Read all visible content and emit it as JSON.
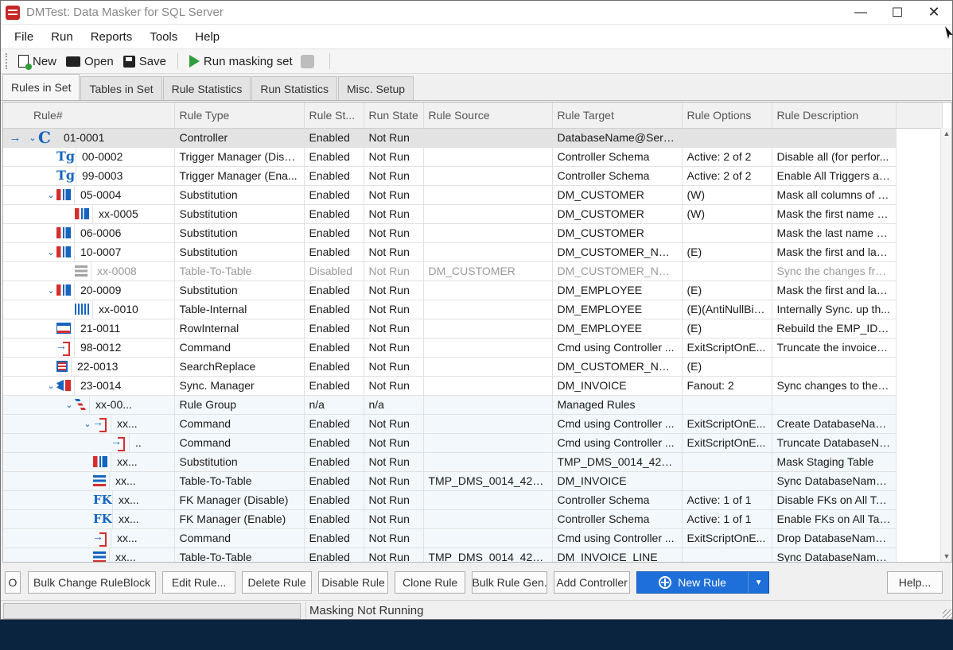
{
  "window": {
    "title": "DMTest: Data Masker for SQL Server"
  },
  "menu": [
    "File",
    "Run",
    "Reports",
    "Tools",
    "Help"
  ],
  "toolbar": {
    "new": "New",
    "open": "Open",
    "save": "Save",
    "run": "Run masking set"
  },
  "tabs": [
    "Rules in Set",
    "Tables in Set",
    "Rule Statistics",
    "Run Statistics",
    "Misc. Setup"
  ],
  "grid": {
    "columns": [
      "Rule#",
      "Rule Type",
      "Rule St...",
      "Run State",
      "Rule Source",
      "Rule Target",
      "Rule Options",
      "Rule Description"
    ],
    "rows": [
      {
        "ptr": "→",
        "exp": "⌄",
        "icon": "controller",
        "glyph": "C",
        "indent": 0,
        "num": "01-0001",
        "type": "Controller",
        "status": "Enabled",
        "run": "Not Run",
        "source": "",
        "target": "DatabaseName@Serv...",
        "options": "",
        "desc": "",
        "state": "selected"
      },
      {
        "ptr": "",
        "exp": "",
        "icon": "trigger",
        "glyph": "Tg",
        "indent": 1,
        "num": "00-0002",
        "type": "Trigger Manager (Disa...",
        "status": "Enabled",
        "run": "Not Run",
        "source": "",
        "target": "Controller Schema",
        "options": "Active: 2 of 2",
        "desc": "Disable all  (for perfor...",
        "state": ""
      },
      {
        "ptr": "",
        "exp": "",
        "icon": "trigger",
        "glyph": "Tg",
        "indent": 1,
        "num": "99-0003",
        "type": "Trigger Manager (Ena...",
        "status": "Enabled",
        "run": "Not Run",
        "source": "",
        "target": "Controller Schema",
        "options": "Active: 2 of 2",
        "desc": "Enable All Triggers again",
        "state": ""
      },
      {
        "ptr": "",
        "exp": "⌄",
        "icon": "subst",
        "glyph": "",
        "indent": 1,
        "num": "05-0004",
        "type": "Substitution",
        "status": "Enabled",
        "run": "Not Run",
        "source": "",
        "target": "DM_CUSTOMER",
        "options": "(W)",
        "desc": "Mask all columns of th...",
        "state": ""
      },
      {
        "ptr": "",
        "exp": "",
        "icon": "subst",
        "glyph": "",
        "indent": 2,
        "num": "xx-0005",
        "type": "Substitution",
        "status": "Enabled",
        "run": "Not Run",
        "source": "",
        "target": "DM_CUSTOMER",
        "options": "(W)",
        "desc": "Mask the first name c...",
        "state": ""
      },
      {
        "ptr": "",
        "exp": "",
        "icon": "subst",
        "glyph": "",
        "indent": 1,
        "num": "06-0006",
        "type": "Substitution",
        "status": "Enabled",
        "run": "Not Run",
        "source": "",
        "target": "DM_CUSTOMER",
        "options": "",
        "desc": "Mask the last name co...",
        "state": ""
      },
      {
        "ptr": "",
        "exp": "⌄",
        "icon": "subst",
        "glyph": "",
        "indent": 1,
        "num": "10-0007",
        "type": "Substitution",
        "status": "Enabled",
        "run": "Not Run",
        "source": "",
        "target": "DM_CUSTOMER_NOTES",
        "options": "(E)",
        "desc": "Mask the first and last...",
        "state": ""
      },
      {
        "ptr": "",
        "exp": "",
        "icon": "t2t dis",
        "glyph": "",
        "indent": 2,
        "num": "xx-0008",
        "type": "Table-To-Table",
        "status": "Disabled",
        "run": "Not Run",
        "source": "DM_CUSTOMER",
        "target": "DM_CUSTOMER_NOTES",
        "options": "",
        "desc": "Sync the changes fro...",
        "state": "disabled"
      },
      {
        "ptr": "",
        "exp": "⌄",
        "icon": "subst",
        "glyph": "",
        "indent": 1,
        "num": "20-0009",
        "type": "Substitution",
        "status": "Enabled",
        "run": "Not Run",
        "source": "",
        "target": "DM_EMPLOYEE",
        "options": "(E)",
        "desc": "Mask the first and last...",
        "state": ""
      },
      {
        "ptr": "",
        "exp": "",
        "icon": "tint",
        "glyph": "",
        "indent": 2,
        "num": "xx-0010",
        "type": "Table-Internal",
        "status": "Enabled",
        "run": "Not Run",
        "source": "",
        "target": "DM_EMPLOYEE",
        "options": "(E)(AntiNullBias)",
        "desc": "Internally Sync. up th...",
        "state": ""
      },
      {
        "ptr": "",
        "exp": "",
        "icon": "rowint",
        "glyph": "",
        "indent": 1,
        "num": "21-0011",
        "type": "RowInternal",
        "status": "Enabled",
        "run": "Not Run",
        "source": "",
        "target": "DM_EMPLOYEE",
        "options": "(E)",
        "desc": "Rebuild the EMP_ID fi...",
        "state": ""
      },
      {
        "ptr": "",
        "exp": "",
        "icon": "cmd",
        "glyph": "",
        "indent": 1,
        "num": "98-0012",
        "type": "Command",
        "status": "Enabled",
        "run": "Not Run",
        "source": "",
        "target": "Cmd using Controller ...",
        "options": "ExitScriptOnE...",
        "desc": "Truncate the invoice_...",
        "state": ""
      },
      {
        "ptr": "",
        "exp": "",
        "icon": "sr",
        "glyph": "",
        "indent": 1,
        "num": "22-0013",
        "type": "SearchReplace",
        "status": "Enabled",
        "run": "Not Run",
        "source": "",
        "target": "DM_CUSTOMER_NOTES",
        "options": "(E)",
        "desc": "",
        "state": ""
      },
      {
        "ptr": "",
        "exp": "⌄",
        "icon": "sync",
        "glyph": "",
        "indent": 1,
        "num": "23-0014",
        "type": "Sync. Manager",
        "status": "Enabled",
        "run": "Not Run",
        "source": "",
        "target": "DM_INVOICE",
        "options": "Fanout: 2",
        "desc": "Sync changes to the I...",
        "state": ""
      },
      {
        "ptr": "",
        "exp": "⌄",
        "icon": "group",
        "glyph": "",
        "indent": 2,
        "num": "xx-00...",
        "type": "Rule Group",
        "status": "n/a",
        "run": "n/a",
        "source": "",
        "target": "Managed Rules",
        "options": "",
        "desc": "",
        "state": "alt"
      },
      {
        "ptr": "",
        "exp": "⌄",
        "icon": "cmd",
        "glyph": "",
        "indent": 3,
        "num": "xx...",
        "type": "Command",
        "status": "Enabled",
        "run": "Not Run",
        "source": "",
        "target": "Cmd using Controller ...",
        "options": "ExitScriptOnE...",
        "desc": "Create DatabaseNam...",
        "state": "alt"
      },
      {
        "ptr": "",
        "exp": "",
        "icon": "cmd",
        "glyph": "",
        "indent": 4,
        "num": "..",
        "type": "Command",
        "status": "Enabled",
        "run": "Not Run",
        "source": "",
        "target": "Cmd using Controller ...",
        "options": "ExitScriptOnE...",
        "desc": "Truncate DatabaseNa...",
        "state": "alt"
      },
      {
        "ptr": "",
        "exp": "",
        "icon": "subst",
        "glyph": "",
        "indent": 3,
        "num": "xx...",
        "type": "Substitution",
        "status": "Enabled",
        "run": "Not Run",
        "source": "",
        "target": "TMP_DMS_0014_426...",
        "options": "",
        "desc": "Mask Staging Table",
        "state": "alt"
      },
      {
        "ptr": "",
        "exp": "",
        "icon": "t2t",
        "glyph": "",
        "indent": 3,
        "num": "xx...",
        "type": "Table-To-Table",
        "status": "Enabled",
        "run": "Not Run",
        "source": "TMP_DMS_0014_426...",
        "target": "DM_INVOICE",
        "options": "",
        "desc": "Sync DatabaseName....",
        "state": "alt"
      },
      {
        "ptr": "",
        "exp": "",
        "icon": "fk",
        "glyph": "FK",
        "indent": 3,
        "num": "xx...",
        "type": "FK Manager (Disable)",
        "status": "Enabled",
        "run": "Not Run",
        "source": "",
        "target": "Controller Schema",
        "options": "Active: 1 of 1",
        "desc": "Disable FKs on All Tar...",
        "state": "alt"
      },
      {
        "ptr": "",
        "exp": "",
        "icon": "fk",
        "glyph": "FK",
        "indent": 3,
        "num": "xx...",
        "type": "FK Manager (Enable)",
        "status": "Enabled",
        "run": "Not Run",
        "source": "",
        "target": "Controller Schema",
        "options": "Active: 1 of 1",
        "desc": "Enable FKs on All Targ...",
        "state": "alt"
      },
      {
        "ptr": "",
        "exp": "",
        "icon": "cmd",
        "glyph": "",
        "indent": 3,
        "num": "xx...",
        "type": "Command",
        "status": "Enabled",
        "run": "Not Run",
        "source": "",
        "target": "Cmd using Controller ...",
        "options": "ExitScriptOnE...",
        "desc": "Drop DatabaseName....",
        "state": "alt"
      },
      {
        "ptr": "",
        "exp": "",
        "icon": "t2t",
        "glyph": "",
        "indent": 3,
        "num": "xx...",
        "type": "Table-To-Table",
        "status": "Enabled",
        "run": "Not Run",
        "source": "TMP_DMS_0014_426...",
        "target": "DM_INVOICE_LINE",
        "options": "",
        "desc": "Sync DatabaseName....",
        "state": "alt"
      }
    ]
  },
  "buttons": {
    "small": "O",
    "bulk_change": "Bulk Change RuleBlock",
    "edit": "Edit Rule...",
    "delete": "Delete Rule",
    "disable": "Disable Rule",
    "clone": "Clone Rule",
    "bulk_gen": "Bulk Rule Gen.",
    "add_controller": "Add Controller",
    "new_rule": "New Rule",
    "help": "Help..."
  },
  "status": {
    "text": "Masking Not Running",
    "progress": 0
  }
}
